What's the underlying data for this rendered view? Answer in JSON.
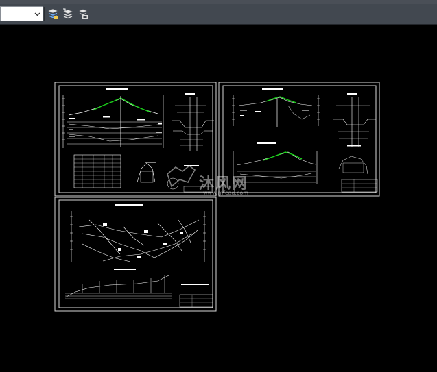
{
  "toolbar": {
    "layer_combo": {
      "value": ""
    },
    "buttons": [
      {
        "icon": "layer-properties-icon"
      },
      {
        "icon": "layer-state-icon"
      },
      {
        "icon": "layer-previous-icon"
      }
    ]
  },
  "drawing": {
    "background": "#000000",
    "frame_color": "#d9d9d9",
    "line_color": "#ffffff",
    "highlight_color": "#19d219",
    "sheets": [
      {
        "name": "sheet-1"
      },
      {
        "name": "sheet-2"
      },
      {
        "name": "sheet-3"
      }
    ]
  },
  "watermark": {
    "brand": "沐风网",
    "url": "www.mfcad.com"
  }
}
